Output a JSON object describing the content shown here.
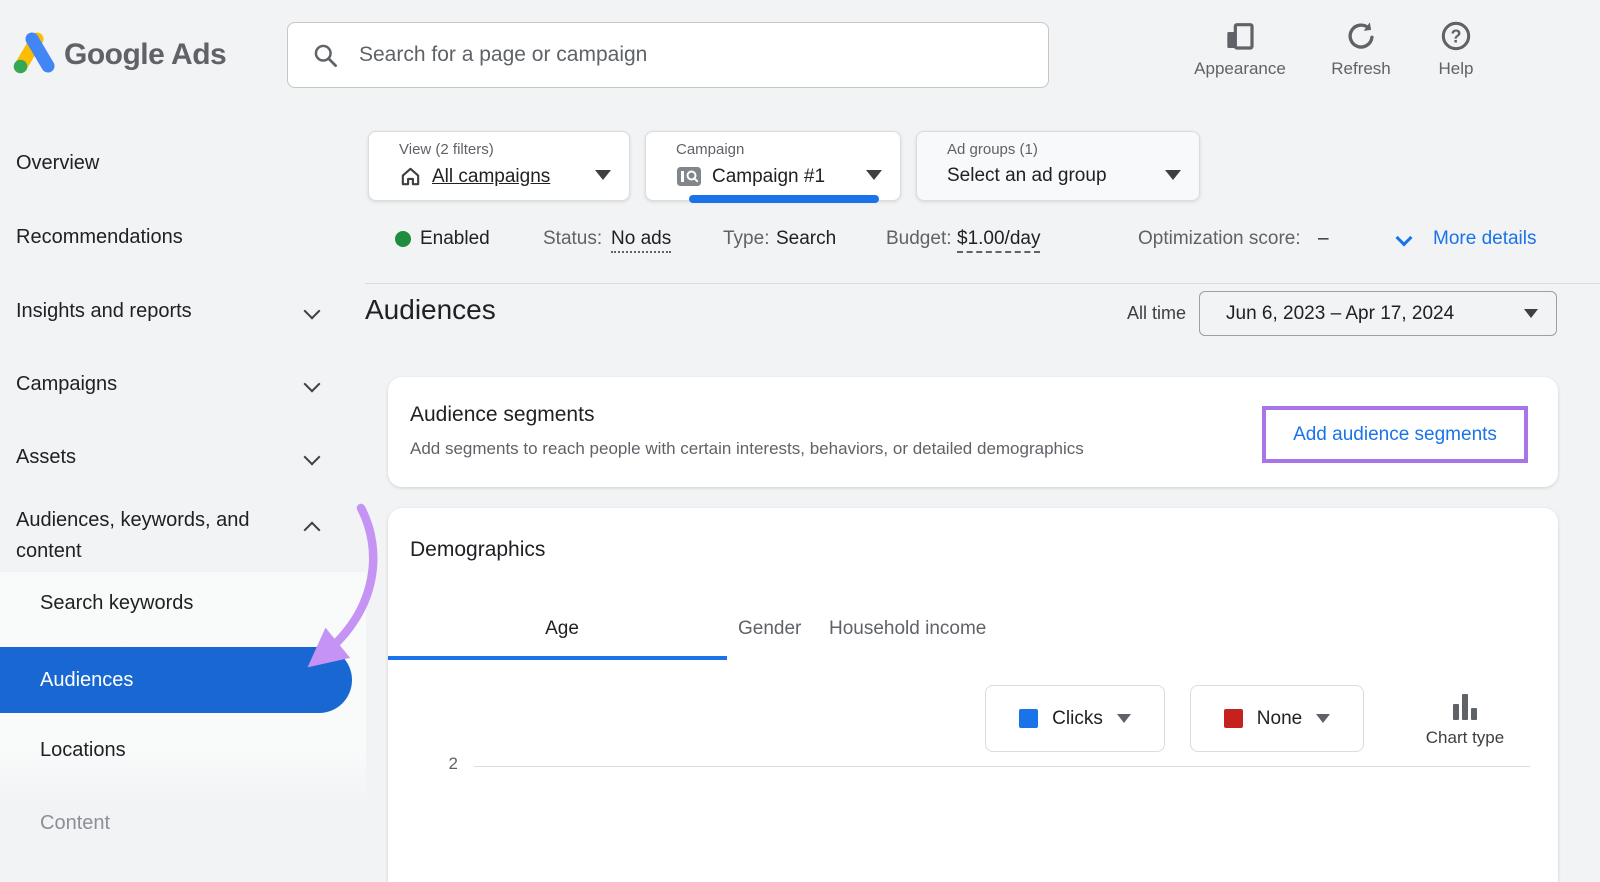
{
  "app": {
    "brand": "Google Ads"
  },
  "topbar": {
    "search": {
      "placeholder": "Search for a page or campaign"
    },
    "actions": {
      "appearance": "Appearance",
      "refresh": "Refresh",
      "help": "Help"
    }
  },
  "sidebar": {
    "items": [
      {
        "label": "Overview"
      },
      {
        "label": "Recommendations"
      },
      {
        "label": "Insights and reports"
      },
      {
        "label": "Campaigns"
      },
      {
        "label": "Assets"
      },
      {
        "label": "Audiences, keywords, and content"
      }
    ],
    "subitems": [
      {
        "label": "Search keywords"
      },
      {
        "label": "Audiences",
        "active": true
      },
      {
        "label": "Locations"
      },
      {
        "label": "Content",
        "disabled": true
      }
    ]
  },
  "filters": {
    "view": {
      "label": "View (2 filters)",
      "value": "All campaigns"
    },
    "campaign": {
      "label": "Campaign",
      "value": "Campaign #1"
    },
    "ad_groups": {
      "label": "Ad groups (1)",
      "value": "Select an ad group"
    }
  },
  "status": {
    "enabled": "Enabled",
    "status_label": "Status:",
    "status_value": "No ads",
    "type_label": "Type:",
    "type_value": "Search",
    "budget_label": "Budget:",
    "budget_value": "$1.00/day",
    "optimization_label": "Optimization score:",
    "optimization_value": "–",
    "more_details": "More details"
  },
  "page": {
    "title": "Audiences",
    "date_preset": "All time",
    "date_range": "Jun 6, 2023 – Apr 17, 2024"
  },
  "segments": {
    "title": "Audience segments",
    "description": "Add segments to reach people with certain interests, behaviors, or detailed demographics",
    "cta": "Add audience segments"
  },
  "demographics": {
    "title": "Demographics",
    "tabs": [
      {
        "label": "Age",
        "active": true
      },
      {
        "label": "Gender"
      },
      {
        "label": "Household income"
      }
    ],
    "metric_primary": "Clicks",
    "metric_secondary": "None",
    "chart_type": "Chart type",
    "chart": {
      "visible_y_tick": "2"
    }
  },
  "colors": {
    "accent_blue": "#1a73e8",
    "active_nav_blue": "#1967d2",
    "enabled_green": "#1e8e3e",
    "metric_primary_swatch": "#1a73e8",
    "metric_secondary_swatch": "#c5221f",
    "annotation_purple": "#a874e8",
    "annotation_arrow_purple": "#c493f3"
  }
}
